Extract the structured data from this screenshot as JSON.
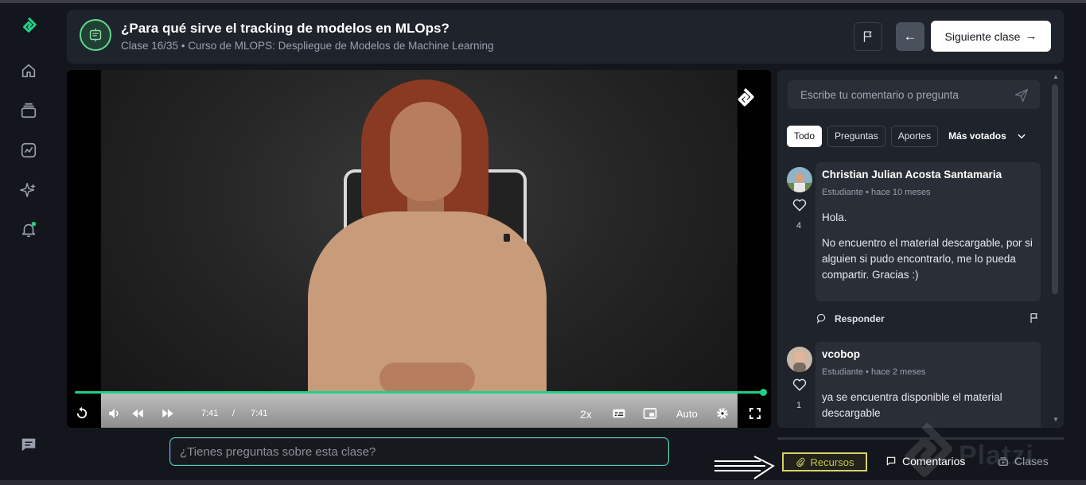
{
  "header": {
    "title": "¿Para qué sirve el tracking de modelos en MLOps?",
    "subtitle": "Clase 16/35 • Curso de MLOPS: Despliegue de Modelos de Machine Learning",
    "next_label": "Siguiente clase",
    "next_arrow": "→",
    "back_arrow": "←"
  },
  "sidebar": {
    "items": [
      "logo-icon",
      "home-icon",
      "courses-icon",
      "progress-icon",
      "sparkle-icon",
      "bell-icon",
      "chat-icon"
    ],
    "notification_color": "#1fd087"
  },
  "player": {
    "current_time": "7:41",
    "separator": "/",
    "duration": "7:41",
    "progress": 1.0,
    "speed": "2x",
    "quality": "Auto",
    "accent": "#1fd087"
  },
  "bottom": {
    "question_placeholder": "¿Tienes preguntas sobre esta clase?",
    "tabs": [
      {
        "label": "Recursos"
      },
      {
        "label": "Comentarios"
      },
      {
        "label": "Clases"
      }
    ],
    "watermark": "Platzi"
  },
  "comments": {
    "input_placeholder": "Escribe tu comentario o pregunta",
    "filters": [
      "Todo",
      "Preguntas",
      "Aportes"
    ],
    "sort_label": "Más votados",
    "items": [
      {
        "author": "Christian Julian Acosta Santamaria",
        "role": "Estudiante",
        "time": "hace 10 meses",
        "likes": "4",
        "body": [
          "Hola.",
          "No encuentro el material descargable, por si alguien si pudo encontrarlo, me lo pueda compartir. Gracias :)"
        ],
        "reply_label": "Responder"
      },
      {
        "author": "vcobop",
        "role": "Estudiante",
        "time": "hace 2 meses",
        "likes": "1",
        "body": [
          "ya se encuentra disponible el material descargable"
        ]
      }
    ]
  }
}
